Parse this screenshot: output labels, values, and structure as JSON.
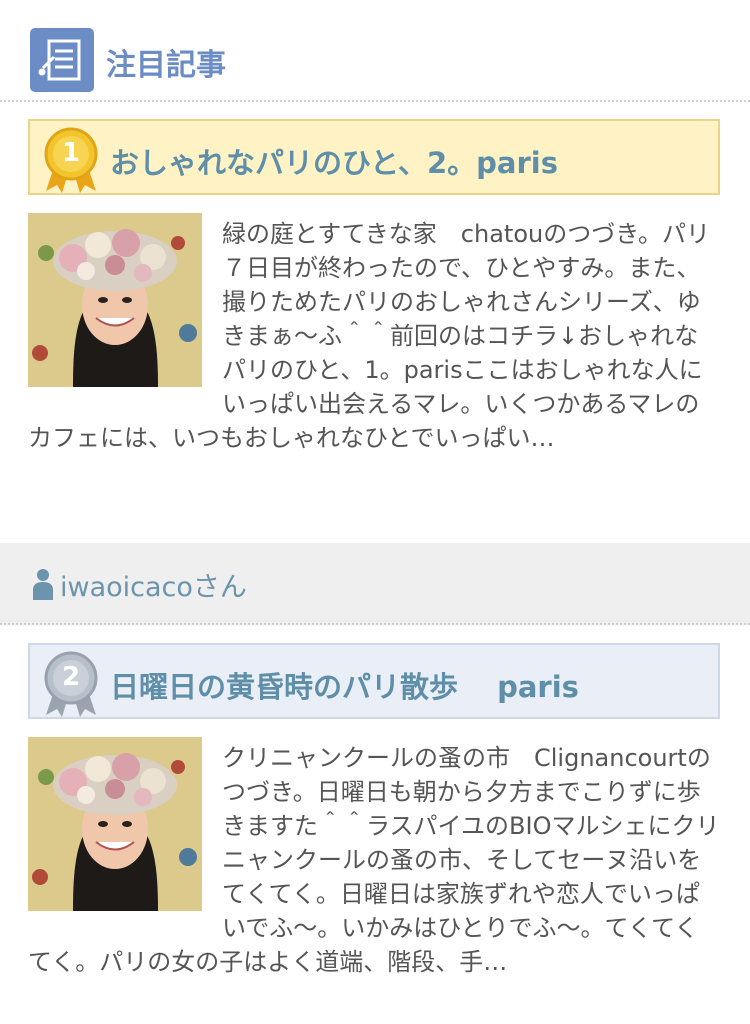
{
  "header": {
    "title": "注目記事",
    "icon": "article-list-icon"
  },
  "articles": [
    {
      "rank": "1",
      "badge_color": "#f0b41e",
      "title": "おしゃれなパリのひと、2。paris",
      "thumbnail": "author-photo",
      "excerpt": "緑の庭とすてきな家　chatouのつづき。パリ７日目が終わったので、ひとやすみ。また、撮りためたパリのおしゃれさんシリーズ、ゆきまぁ〜ふ＾＾前回のはコチラ↓おしゃれなパリのひと、1。parisここはおしゃれな人にいっぱい出会えるマレ。いくつかあるマレのカフェには、いつもおしゃれなひとでいっぱい…"
    },
    {
      "rank": "2",
      "badge_color": "#a6b0bc",
      "title": "日曜日の黄昏時のパリ散歩　 paris",
      "thumbnail": "author-photo",
      "excerpt": "クリニャンクールの蚤の市　Clignancourtのつづき。日曜日も朝から夕方までこりずに歩きますた＾＾ラスパイユのBIOマルシェにクリニャンクールの蚤の市、そしてセーヌ沿いをてくてく。日曜日は家族ずれや恋人でいっぱいでふ〜。いかみはひとりでふ〜。てくてくてく。パリの女の子はよく道端、階段、手…"
    }
  ],
  "author": {
    "name": "iwaoicacoさん",
    "icon": "person-icon"
  }
}
